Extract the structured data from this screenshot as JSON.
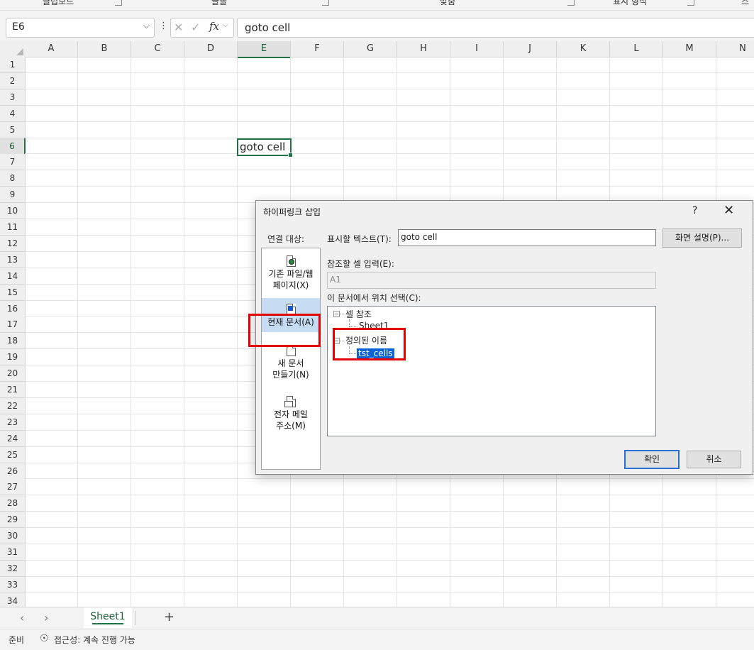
{
  "ribbon": {
    "groups": [
      "클립보드",
      "글꼴",
      "맞춤",
      "표시 형식",
      "스"
    ]
  },
  "formula_bar": {
    "name_box": "E6",
    "formula": "goto cell",
    "fx_label": "fx"
  },
  "grid": {
    "columns": [
      "A",
      "B",
      "C",
      "D",
      "E",
      "F",
      "G",
      "H",
      "I",
      "J",
      "K",
      "L",
      "M",
      "N"
    ],
    "rows": [
      "1",
      "2",
      "3",
      "4",
      "5",
      "6",
      "7",
      "8",
      "9",
      "10",
      "11",
      "12",
      "13",
      "14",
      "15",
      "16",
      "17",
      "18",
      "19",
      "20",
      "21",
      "22",
      "23",
      "24",
      "25",
      "26",
      "27",
      "28",
      "29",
      "30",
      "31",
      "32",
      "33",
      "34"
    ],
    "selected_column": "E",
    "selected_row": "6",
    "active_cell_text": "goto cell"
  },
  "sheet_tabs": {
    "tabs": [
      "Sheet1"
    ],
    "add_label": "+"
  },
  "status_bar": {
    "ready": "준비",
    "accessibility": "접근성: 계속 진행 가능"
  },
  "dialog": {
    "title": "하이퍼링크 삽입",
    "help": "?",
    "close": "✕",
    "link_to_label": "연결 대상:",
    "link_items": [
      {
        "line1": "기존 파일/웹",
        "line2": "페이지(X)",
        "icon": "existing-file-web-icon"
      },
      {
        "line1": "현재 문서(A)",
        "line2": "",
        "icon": "place-in-document-icon"
      },
      {
        "line1": "새 문서",
        "line2": "만들기(N)",
        "icon": "new-document-icon"
      },
      {
        "line1": "전자 메일",
        "line2": "주소(M)",
        "icon": "email-address-icon"
      }
    ],
    "selected_link_item": "현재 문서(A)",
    "display_text_label": "표시할 텍스트(T):",
    "display_text_value": "goto cell",
    "screentip_button": "화면 설명(P)...",
    "cell_ref_label": "참조할 셀 입력(E):",
    "cell_ref_value": "A1",
    "place_label": "이 문서에서 위치 선택(C):",
    "tree": {
      "cell_ref_node": "셀 참조",
      "sheet_node": "Sheet1",
      "defined_names_node": "정의된 이름",
      "name_node": "tst_cells"
    },
    "ok_button": "확인",
    "cancel_button": "취소"
  },
  "colors": {
    "excel_green": "#217346",
    "highlight_red": "#e40000",
    "selection_blue": "#0a64d6"
  }
}
